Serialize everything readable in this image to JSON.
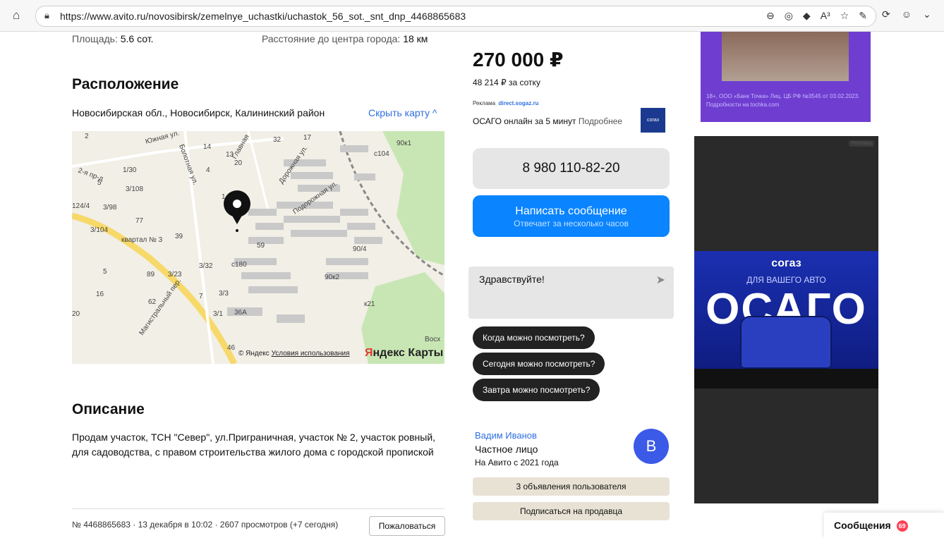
{
  "browser": {
    "url": "https://www.avito.ru/novosibirsk/zemelnye_uchastki/uchastok_56_sot._snt_dnp_4468865683",
    "icons": [
      "home-icon",
      "lock-icon",
      "zoom-out-icon",
      "eye-off-icon",
      "tag-icon",
      "read-aloud-icon",
      "star-icon",
      "extension-icon",
      "collections-icon",
      "profile-icon",
      "more-icon"
    ],
    "readaloud_label": "A³"
  },
  "params": {
    "area_label": "Площадь:",
    "area_value": "5.6 сот.",
    "distance_label": "Расстояние до центра города:",
    "distance_value": "18 км"
  },
  "location": {
    "title": "Расположение",
    "address": "Новосибирская обл., Новосибирск, Калининский район",
    "hide_map": "Скрыть карту ^"
  },
  "map": {
    "labels": {
      "yuzhnaya": "Южная ул.",
      "bolotnaya": "Болотная ул.",
      "glavnaya": "Главная",
      "dorozhnaya": "Дорожная ул.",
      "podorozhnaya": "Подорожная ул.",
      "kvartal": "квартал № 3",
      "magistr": "Магистральный пер.",
      "vosh": "Восх"
    },
    "numbers": [
      "2",
      "5",
      "14",
      "13",
      "20",
      "32",
      "17",
      "4",
      "1/30",
      "3/108",
      "1",
      "124/4",
      "3/98",
      "77",
      "3/104",
      "39",
      "59",
      "3/32",
      "c180",
      "89",
      "3/23",
      "5",
      "16",
      "62",
      "7",
      "3/3",
      "20",
      "3/1",
      "36A",
      "46",
      "90к1",
      "c104",
      "90/4",
      "90к2",
      "2-я пр-д",
      "к21"
    ],
    "zoom_in": "+",
    "zoom_out": "−",
    "locate": "➤",
    "copyright_yandex": "© Яндекс",
    "terms": "Условия использования",
    "brand_y": "Я",
    "brand_rest": "ндекс Карты"
  },
  "description": {
    "title": "Описание",
    "text": "Продам участок, ТСН \"Север\", ул.Пригpаничная, участок № 2, участок ровный, для садоводства, с правом строительства жилого дома с городской пропиской"
  },
  "footer": {
    "meta": "№ 4468865683 · 13 декабря в 10:02 · 2607 просмотров (+7 сегодня)",
    "report": "Пожаловаться"
  },
  "sidebar": {
    "price": "270 000 ₽",
    "per_unit": "48 214 ₽ за сотку",
    "ad_label": "Реклама",
    "ad_domain": "direct.sogaz.ru",
    "ad_text": "ОСАГО онлайн за 5 минут",
    "ad_more": "Подробнее",
    "ad_logo": "согаз",
    "phone": "8 980 110-82-20",
    "message_btn": "Написать сообщение",
    "message_sub": "Отвечает за несколько часов",
    "chat_text": "Здравствуйте!",
    "quick": [
      "Когда можно посмотреть?",
      "Сегодня можно посмотреть?",
      "Завтра можно посмотреть?"
    ],
    "seller_name": "Вадим Иванов",
    "seller_type": "Частное лицо",
    "seller_since": "На Авито с 2021 года",
    "avatar_letter": "В",
    "seller_ads": "3 объявления пользователя",
    "subscribe": "Подписаться на продавца"
  },
  "ads": {
    "banner1_text": "18+, ООО «Банк Точка» Лиц. ЦБ РФ №3545 от 03.02.2023. Подробности на tochka.com",
    "banner2_tag": "Реклама",
    "banner2_brand": "согаз",
    "banner2_sub": "ДЛЯ ВАШЕГО АВТО",
    "banner2_big": "ОСАГО"
  },
  "messenger": {
    "label": "Сообщения",
    "count": "69"
  }
}
